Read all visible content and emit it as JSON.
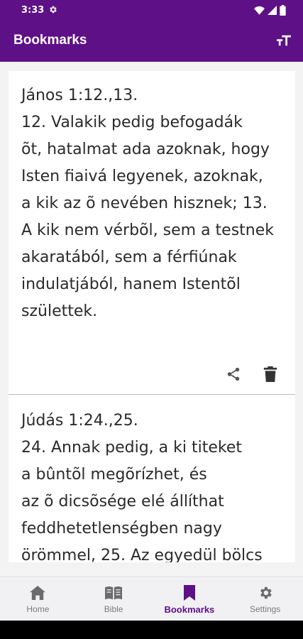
{
  "status": {
    "time": "3:33"
  },
  "appbar": {
    "title": "Bookmarks"
  },
  "bookmarks": [
    {
      "reference": "János 1:12.,13.",
      "lines": [
        "12. Valakik pedig befogadák",
        "õt, hatalmat ada azoknak, hogy",
        "Isten fiaivá legyenek, azoknak,",
        "a kik az õ nevében hisznek; 13.",
        "A kik nem vérbõl, sem a testnek",
        "akaratából, sem a férfiúnak",
        "indulatjából, hanem Istentõl",
        "születtek."
      ]
    },
    {
      "reference": "Júdás 1:24.,25.",
      "lines": [
        "24. Annak pedig, a ki titeket",
        "a bûntõl megõrízhet, és",
        "az õ dicsõsége elé állíthat",
        "feddhetetlenségben nagy",
        "örömmel, 25. Az egyedül bölcs"
      ]
    }
  ],
  "bottom_nav": {
    "items": [
      {
        "label": "Home",
        "icon": "home-icon"
      },
      {
        "label": "Bible",
        "icon": "book-icon"
      },
      {
        "label": "Bookmarks",
        "icon": "bookmark-icon",
        "active": true
      },
      {
        "label": "Settings",
        "icon": "gear-icon"
      }
    ]
  },
  "colors": {
    "primary": "#5e1087",
    "nav_inactive": "#7a7a7a",
    "text": "#2a2a2a"
  }
}
